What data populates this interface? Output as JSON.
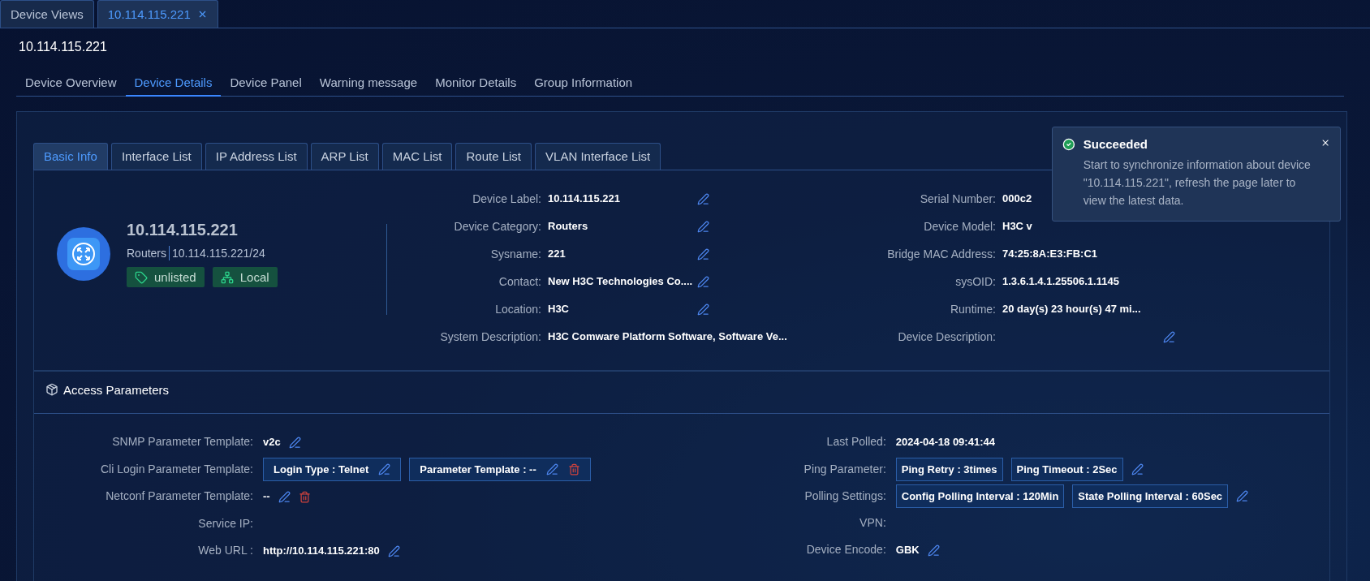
{
  "window_tabs": [
    {
      "label": "Device Views",
      "selected": false
    },
    {
      "label": "10.114.115.221",
      "selected": true,
      "closable": true
    }
  ],
  "page_title": "10.114.115.221",
  "section_tabs": [
    {
      "label": "Device Overview",
      "selected": false
    },
    {
      "label": "Device Details",
      "selected": true
    },
    {
      "label": "Device Panel",
      "selected": false
    },
    {
      "label": "Warning message",
      "selected": false
    },
    {
      "label": "Monitor Details",
      "selected": false
    },
    {
      "label": "Group Information",
      "selected": false
    }
  ],
  "detail_tabs": [
    {
      "label": "Basic Info",
      "selected": true
    },
    {
      "label": "Interface List",
      "selected": false
    },
    {
      "label": "IP Address List",
      "selected": false
    },
    {
      "label": "ARP List",
      "selected": false
    },
    {
      "label": "MAC List",
      "selected": false
    },
    {
      "label": "Route List",
      "selected": false
    },
    {
      "label": "VLAN Interface List",
      "selected": false
    }
  ],
  "profile": {
    "name": "10.114.115.221",
    "category": "Routers",
    "address": "10.114.115.221/24",
    "tags": [
      {
        "label": "unlisted",
        "kind": "tag"
      },
      {
        "label": "Local",
        "kind": "network"
      }
    ]
  },
  "basic_left": [
    {
      "label": "Device Label:",
      "value": "10.114.115.221",
      "editable": true
    },
    {
      "label": "Device Category:",
      "value": "Routers",
      "editable": true
    },
    {
      "label": "Sysname:",
      "value": "221",
      "editable": true
    },
    {
      "label": "Contact:",
      "value": "New H3C Technologies Co....",
      "editable": true
    },
    {
      "label": "Location:",
      "value": "H3C",
      "editable": true
    },
    {
      "label": "System Description:",
      "value": "H3C Comware Platform Software, Software Ve..."
    }
  ],
  "basic_right": [
    {
      "label": "Serial Number:",
      "value": "000c2"
    },
    {
      "label": "Device Model:",
      "value": "H3C v"
    },
    {
      "label": "Bridge MAC Address:",
      "value": "74:25:8A:E3:FB:C1"
    },
    {
      "label": "sysOID:",
      "value": "1.3.6.1.4.1.25506.1.1145"
    },
    {
      "label": "Runtime:",
      "value": "20 day(s) 23 hour(s) 47 mi..."
    },
    {
      "label": "Device Description:",
      "editable": true
    }
  ],
  "access": {
    "title": "Access Parameters",
    "left": [
      {
        "label": "SNMP Parameter Template:",
        "value": "v2c",
        "editable": true
      },
      {
        "label": "Cli Login Parameter Template:",
        "chips": [
          {
            "text": "Login Type : Telnet",
            "editable": true
          },
          {
            "text": "Parameter Template : --",
            "editable": true,
            "deletable": true
          }
        ]
      },
      {
        "label": "Netconf Parameter Template:",
        "value": "--",
        "editable": true,
        "deletable": true
      },
      {
        "label": "Service IP:"
      },
      {
        "label": "Web URL :",
        "value": "http://10.114.115.221:80",
        "editable": true
      }
    ],
    "right": [
      {
        "label": "Last Polled:",
        "value": "2024-04-18 09:41:44"
      },
      {
        "label": "Ping Parameter:",
        "chips": [
          {
            "text": "Ping Retry : 3times"
          },
          {
            "text": "Ping Timeout : 2Sec"
          }
        ],
        "editable": true
      },
      {
        "label": "Polling Settings:",
        "chips": [
          {
            "text": "Config Polling Interval : 120Min"
          },
          {
            "text": "State Polling Interval : 60Sec"
          }
        ],
        "editable": true
      },
      {
        "label": "VPN:"
      },
      {
        "label": "Device Encode:",
        "value": "GBK",
        "editable": true
      }
    ]
  },
  "toast": {
    "title": "Succeeded",
    "message": "Start to synchronize information about device \"10.114.115.221\", refresh the page later to view the latest data."
  }
}
